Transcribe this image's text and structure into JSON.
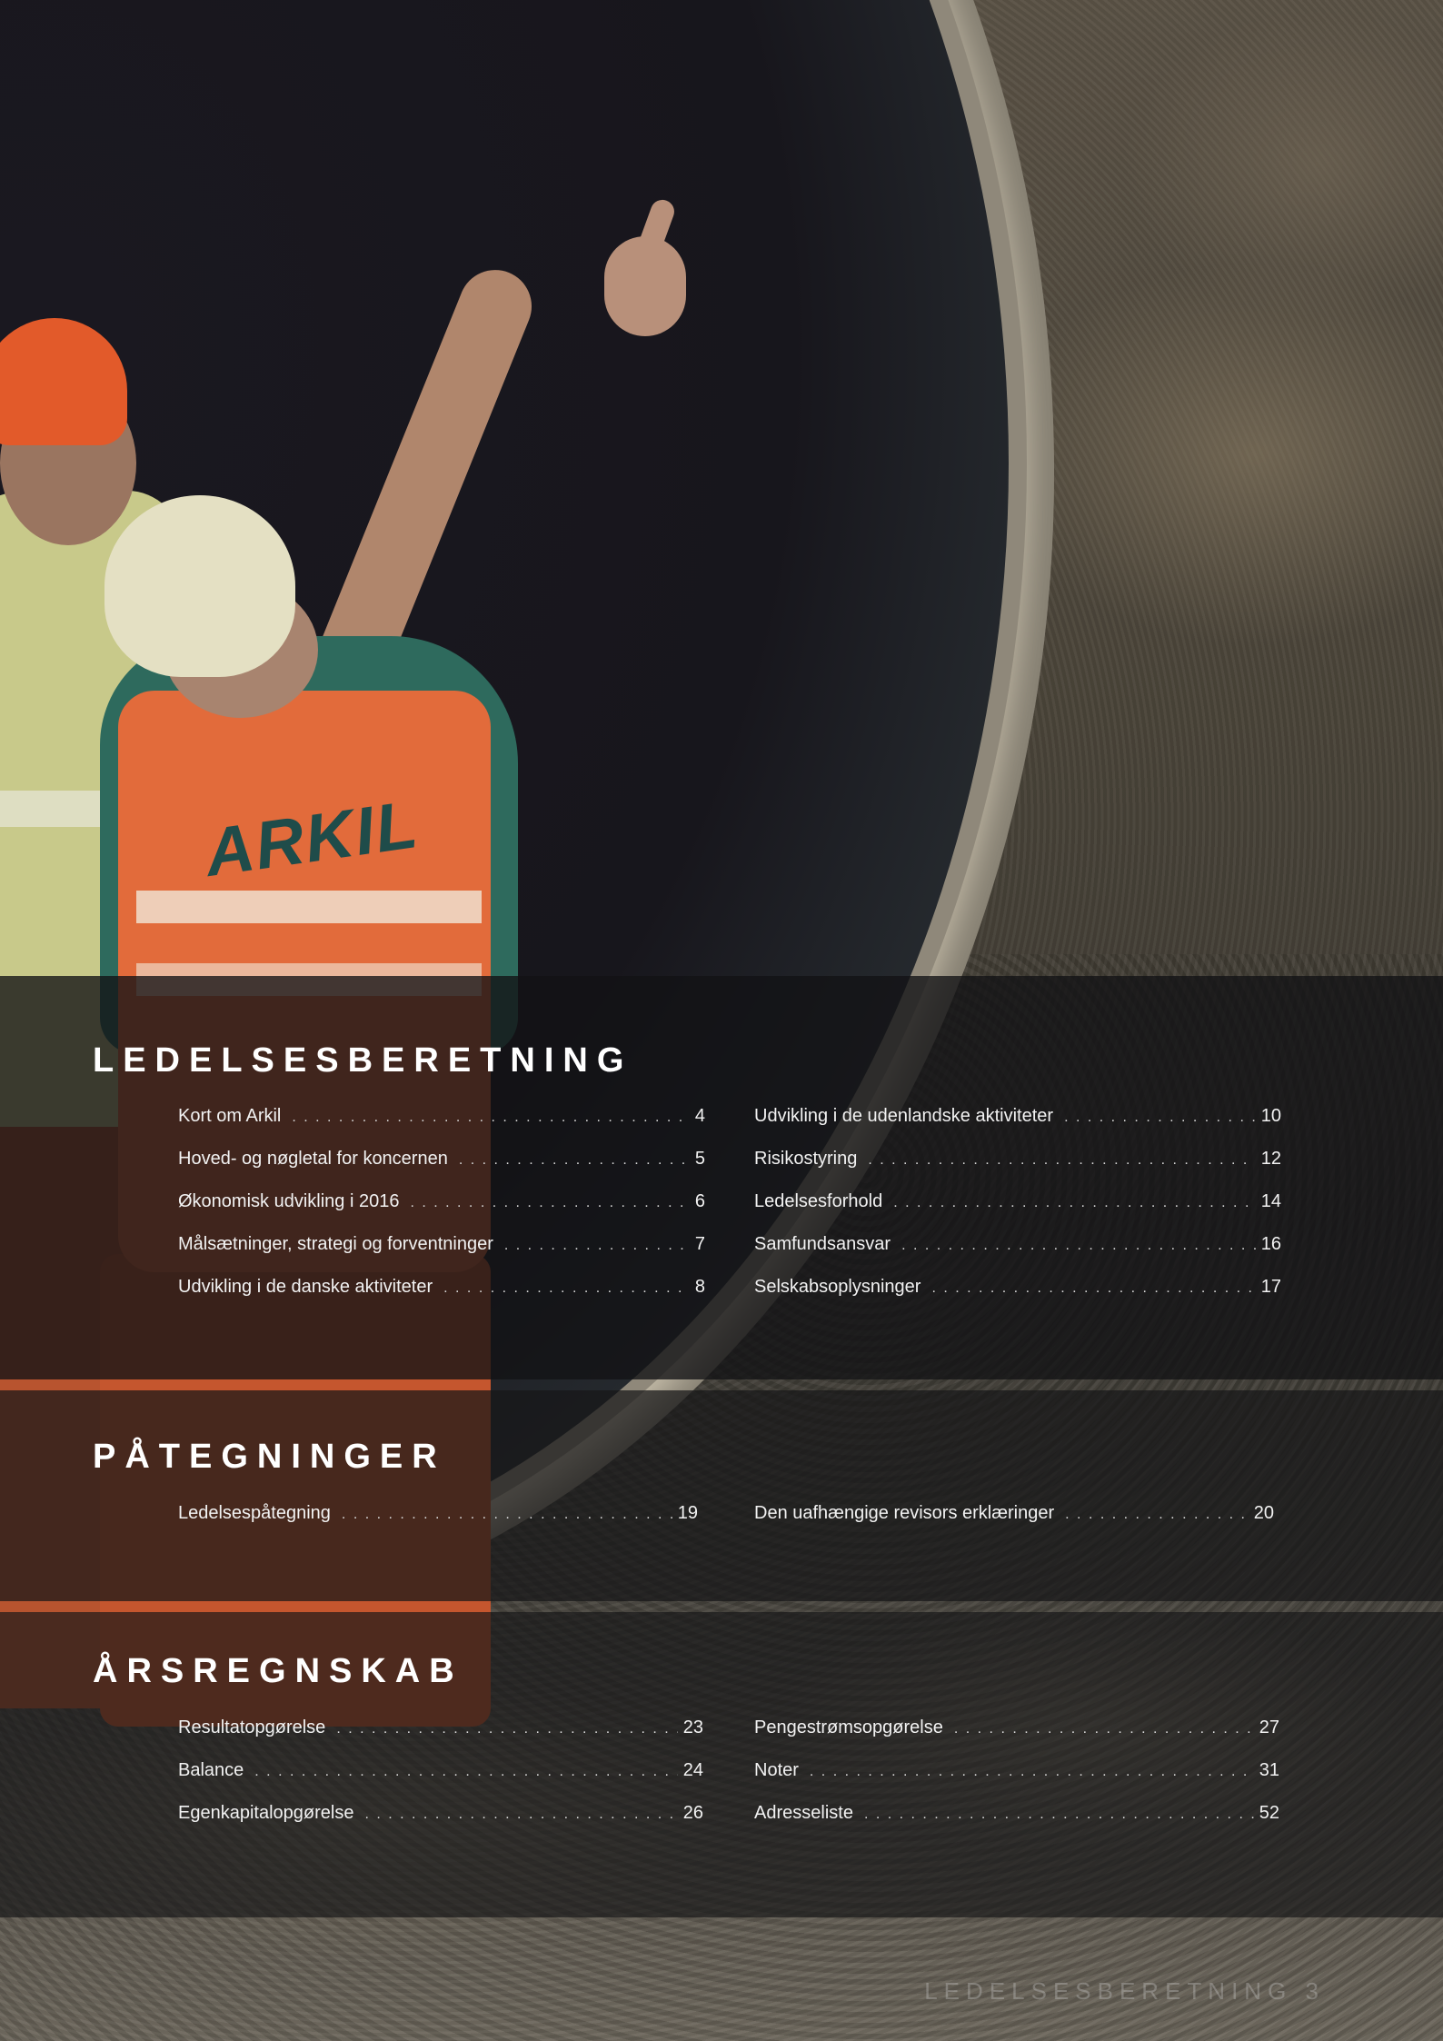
{
  "sections": [
    {
      "title": "LEDELSESBERETNING",
      "left": [
        {
          "label": "Kort om Arkil",
          "page": "4"
        },
        {
          "label": "Hoved- og nøgletal for koncernen",
          "page": "5"
        },
        {
          "label": "Økonomisk udvikling i 2016",
          "page": "6"
        },
        {
          "label": "Målsætninger, strategi og forventninger",
          "page": "7"
        },
        {
          "label": "Udvikling i de danske aktiviteter",
          "page": "8"
        }
      ],
      "right": [
        {
          "label": "Udvikling i de udenlandske aktiviteter",
          "page": "10"
        },
        {
          "label": "Risikostyring",
          "page": "12"
        },
        {
          "label": "Ledelsesforhold",
          "page": "14"
        },
        {
          "label": "Samfundsansvar",
          "page": "16"
        },
        {
          "label": "Selskabsoplysninger",
          "page": "17"
        }
      ]
    },
    {
      "title": "PÅTEGNINGER",
      "left": [
        {
          "label": "Ledelsespåtegning",
          "page": "19"
        }
      ],
      "right": [
        {
          "label": "Den uafhængige revisors erklæringer",
          "page": "20"
        }
      ]
    },
    {
      "title": "ÅRSREGNSKAB",
      "left": [
        {
          "label": "Resultatopgørelse",
          "page": "23"
        },
        {
          "label": "Balance",
          "page": "24"
        },
        {
          "label": "Egenkapitalopgørelse",
          "page": "26"
        }
      ],
      "right": [
        {
          "label": "Pengestrømsopgørelse",
          "page": "27"
        },
        {
          "label": "Noter",
          "page": "31"
        },
        {
          "label": "Adresseliste",
          "page": "52"
        }
      ]
    }
  ],
  "photo": {
    "vest_logo": "ARKIL"
  },
  "footer": {
    "text": "LEDELSESBERETNING 3"
  }
}
